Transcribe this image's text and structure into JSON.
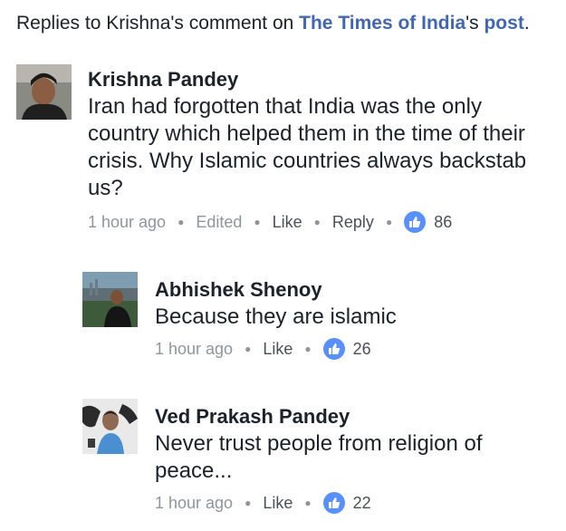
{
  "header": {
    "prefix": "Replies to Krishna's comment on ",
    "page_link": "The Times of India",
    "middle": "'s ",
    "post_link": "post",
    "suffix": "."
  },
  "comments": [
    {
      "author": "Krishna Pandey",
      "text": "Iran had forgotten that India was the only country which helped them in the time of their crisis. Why Islamic countries always backstab us?",
      "time": "1 hour ago",
      "edited": "Edited",
      "like_label": "Like",
      "reply_label": "Reply",
      "like_count": "86",
      "avatar_icon": "profile-photo"
    },
    {
      "author": "Abhishek Shenoy",
      "text": "Because they are islamic",
      "time": "1 hour ago",
      "like_label": "Like",
      "like_count": "26",
      "avatar_icon": "profile-photo"
    },
    {
      "author": "Ved Prakash Pandey",
      "text": "Never trust people from religion of peace...",
      "time": "1 hour ago",
      "like_label": "Like",
      "like_count": "22",
      "avatar_icon": "profile-photo"
    }
  ],
  "colors": {
    "link": "#4267b2",
    "meta": "#90949c",
    "like_badge": "#5890ff"
  }
}
